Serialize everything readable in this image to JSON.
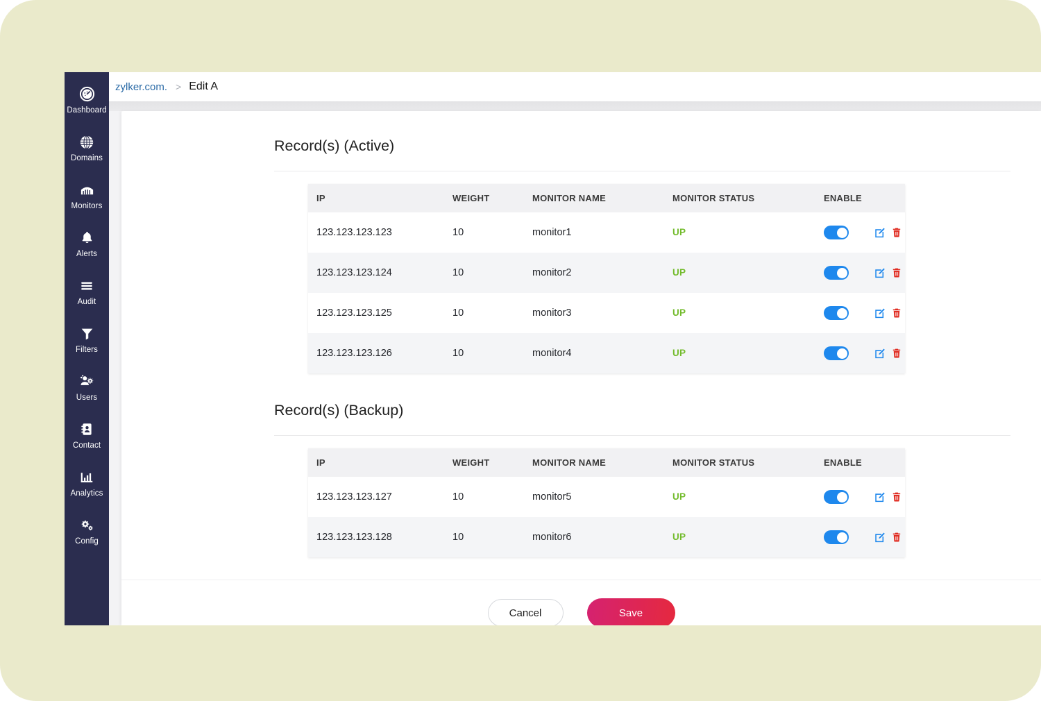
{
  "sidebar": {
    "items": [
      {
        "label": "Dashboard",
        "icon": "gauge-icon"
      },
      {
        "label": "Domains",
        "icon": "globe-icon"
      },
      {
        "label": "Monitors",
        "icon": "server-rack-icon"
      },
      {
        "label": "Alerts",
        "icon": "bell-icon"
      },
      {
        "label": "Audit",
        "icon": "list-lines-icon"
      },
      {
        "label": "Filters",
        "icon": "funnel-icon"
      },
      {
        "label": "Users",
        "icon": "users-gear-icon"
      },
      {
        "label": "Contact",
        "icon": "address-book-icon"
      },
      {
        "label": "Analytics",
        "icon": "bar-chart-icon"
      },
      {
        "label": "Config",
        "icon": "gears-icon"
      }
    ]
  },
  "breadcrumb": {
    "domain": "zylker.com.",
    "separator": ">",
    "current": "Edit A"
  },
  "columns": {
    "ip": "IP",
    "weight": "WEIGHT",
    "monitor_name": "MONITOR NAME",
    "monitor_status": "MONITOR STATUS",
    "enable": "ENABLE"
  },
  "sections": [
    {
      "title": "Record(s) (Active)",
      "rows": [
        {
          "ip": "123.123.123.123",
          "weight": "10",
          "monitor_name": "monitor1",
          "monitor_status": "UP",
          "enabled": true
        },
        {
          "ip": "123.123.123.124",
          "weight": "10",
          "monitor_name": "monitor2",
          "monitor_status": "UP",
          "enabled": true
        },
        {
          "ip": "123.123.123.125",
          "weight": "10",
          "monitor_name": "monitor3",
          "monitor_status": "UP",
          "enabled": true
        },
        {
          "ip": "123.123.123.126",
          "weight": "10",
          "monitor_name": "monitor4",
          "monitor_status": "UP",
          "enabled": true
        }
      ]
    },
    {
      "title": "Record(s) (Backup)",
      "rows": [
        {
          "ip": "123.123.123.127",
          "weight": "10",
          "monitor_name": "monitor5",
          "monitor_status": "UP",
          "enabled": true
        },
        {
          "ip": "123.123.123.128",
          "weight": "10",
          "monitor_name": "monitor6",
          "monitor_status": "UP",
          "enabled": true
        }
      ]
    }
  ],
  "footer": {
    "cancel_label": "Cancel",
    "save_label": "Save"
  },
  "icons": {
    "row_edit": "edit-pencil-square-icon",
    "row_delete": "trash-icon",
    "row_toggle": "enable-toggle"
  },
  "colors": {
    "backdrop": "#eaeacb",
    "sidebar": "#2b2d4f",
    "link": "#2a6aa6",
    "status_up": "#72bb2b",
    "toggle_on": "#1e88ed",
    "edit_icon": "#1e88ed",
    "delete_icon": "#e02b20",
    "save_gradient_start": "#d52270",
    "save_gradient_end": "#e5293f",
    "row_alt": "#f4f5f7",
    "table_header": "#f1f1f3"
  }
}
